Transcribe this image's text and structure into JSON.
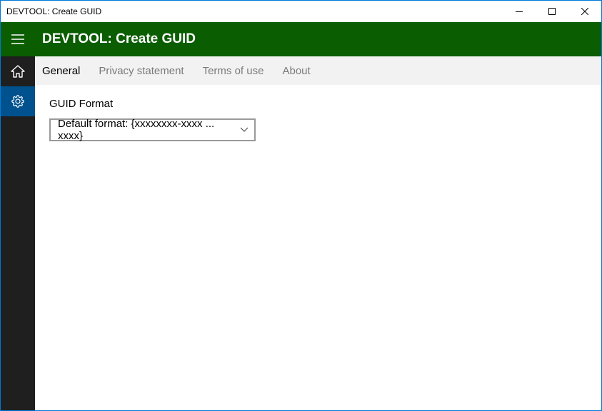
{
  "window": {
    "title": "DEVTOOL: Create GUID"
  },
  "header": {
    "title": "DEVTOOL: Create GUID"
  },
  "tabs": [
    {
      "label": "General",
      "active": true
    },
    {
      "label": "Privacy statement",
      "active": false
    },
    {
      "label": "Terms of use",
      "active": false
    },
    {
      "label": "About",
      "active": false
    }
  ],
  "content": {
    "section_label": "GUID Format",
    "dropdown_value": "Default format: {xxxxxxxx-xxxx ... xxxx}"
  }
}
